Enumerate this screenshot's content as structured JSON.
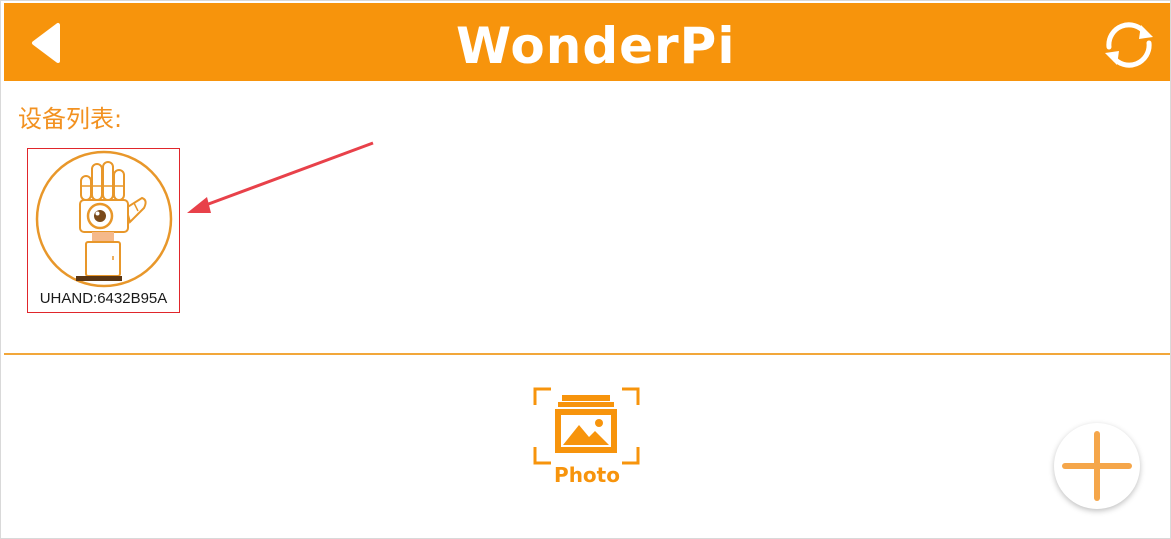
{
  "colors": {
    "accent": "#f7940c",
    "highlight": "#e0262b",
    "annotation_arrow": "#e8414a"
  },
  "header": {
    "back_icon": "back-triangle-icon",
    "logo_text": "WonderPi",
    "refresh_icon": "refresh-icon"
  },
  "device_list": {
    "title": "设备列表:",
    "items": [
      {
        "label": "UHAND:6432B95A",
        "icon": "robot-hand-icon"
      }
    ]
  },
  "bottom": {
    "photo_label": "Photo",
    "photo_icon": "photo-gallery-icon",
    "add_icon": "plus-icon"
  }
}
